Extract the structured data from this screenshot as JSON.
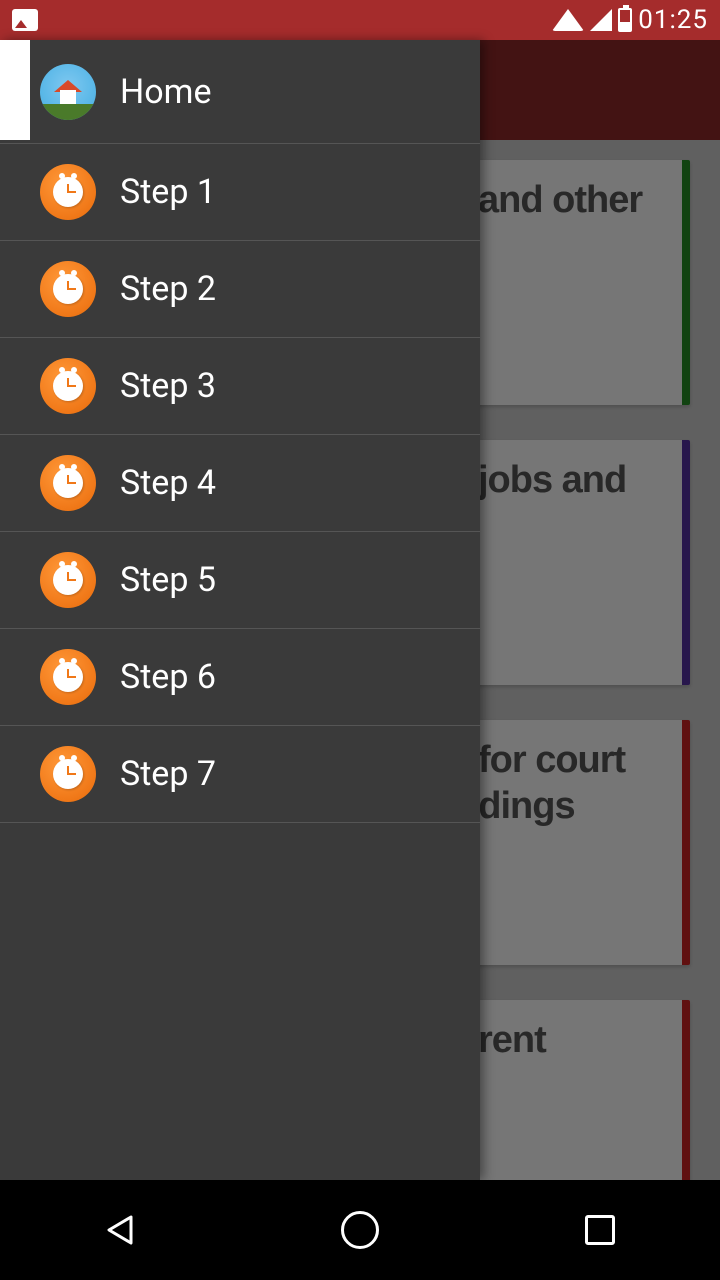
{
  "status": {
    "time": "01:25"
  },
  "drawer": {
    "items": [
      {
        "label": "Home",
        "icon": "home"
      },
      {
        "label": "Step 1",
        "icon": "step"
      },
      {
        "label": "Step 2",
        "icon": "step"
      },
      {
        "label": "Step 3",
        "icon": "step"
      },
      {
        "label": "Step 4",
        "icon": "step"
      },
      {
        "label": "Step 5",
        "icon": "step"
      },
      {
        "label": "Step 6",
        "icon": "step"
      },
      {
        "label": "Step 7",
        "icon": "step"
      }
    ]
  },
  "cards": [
    {
      "title_fragment": "and other",
      "accent": "green"
    },
    {
      "title_fragment": "jobs and",
      "accent": "purple"
    },
    {
      "title_fragment": "for court",
      "title_fragment2": "eedings",
      "accent": "red"
    },
    {
      "title_fragment": "rent",
      "accent": "red"
    }
  ]
}
